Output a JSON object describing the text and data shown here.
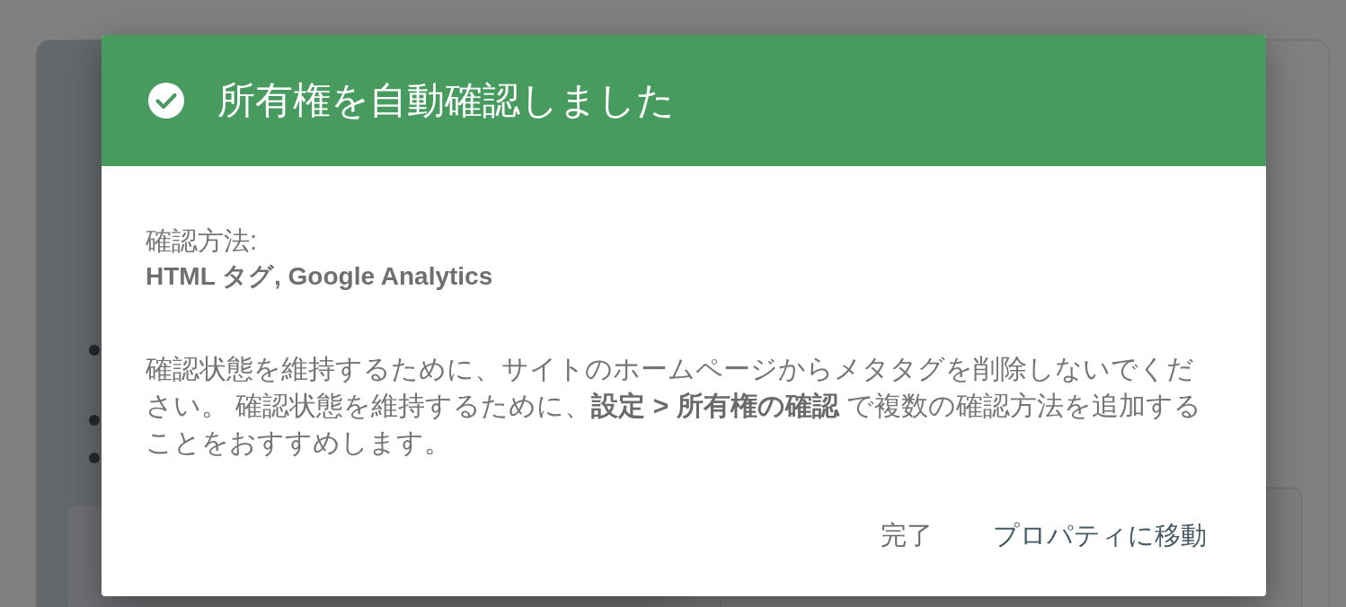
{
  "dialog": {
    "success": true,
    "title": "所有権を自動確認しました",
    "method_label": "確認方法:",
    "method_value": "HTML タグ, Google Analytics",
    "message": "確認状態を維持するために、サイトのホームページからメタタグを削除しないでください。 確認状態を維持するために、**設定 > 所有権の確認** で複数の確認方法を追加することをおすすめします。",
    "buttons": [
      {
        "label": "完了",
        "kind": "secondary"
      },
      {
        "label": "プロパティに移動",
        "kind": "primary"
      }
    ]
  }
}
